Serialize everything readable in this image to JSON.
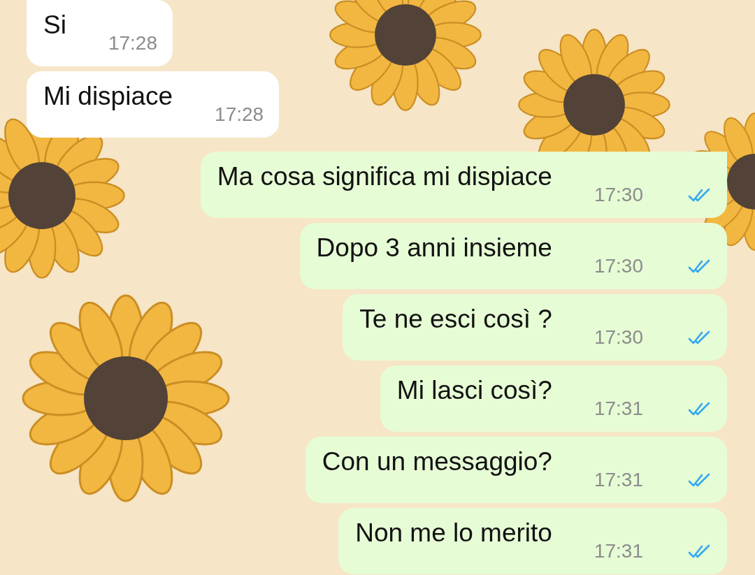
{
  "messages": [
    {
      "kind": "incoming",
      "text": "Si",
      "time": "17:28",
      "tail": true
    },
    {
      "kind": "incoming",
      "text": "Mi dispiace",
      "time": "17:28",
      "tail": false
    },
    {
      "kind": "outgoing",
      "text": "Ma cosa significa mi dispiace",
      "time": "17:30",
      "tail": true,
      "read": true
    },
    {
      "kind": "outgoing",
      "text": "Dopo 3 anni insieme",
      "time": "17:30",
      "tail": false,
      "read": true
    },
    {
      "kind": "outgoing",
      "text": "Te ne esci così ?",
      "time": "17:30",
      "tail": false,
      "read": true
    },
    {
      "kind": "outgoing",
      "text": "Mi lasci così?",
      "time": "17:31",
      "tail": false,
      "read": true
    },
    {
      "kind": "outgoing",
      "text": "Con un messaggio?",
      "time": "17:31",
      "tail": false,
      "read": true
    },
    {
      "kind": "outgoing",
      "text": "Non me lo merito",
      "time": "17:31",
      "tail": false,
      "read": true
    }
  ]
}
